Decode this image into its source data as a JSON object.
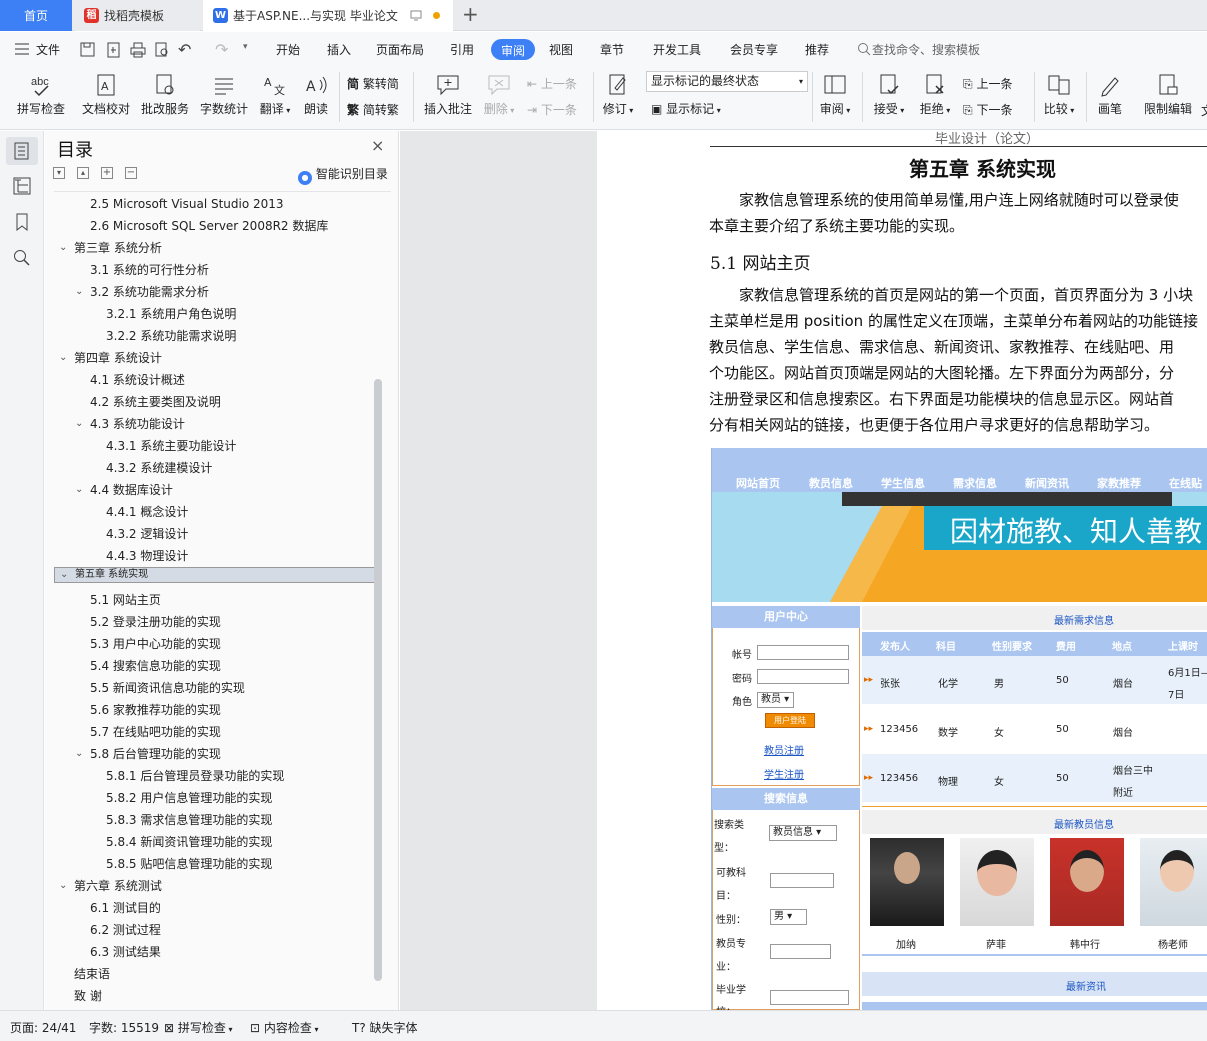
{
  "tabs": {
    "home": "首页",
    "templates": "找稻壳模板",
    "document": "基于ASP.NE...与实现 毕业论文"
  },
  "menu": {
    "file": "文件",
    "items": [
      "开始",
      "插入",
      "页面布局",
      "引用",
      "审阅",
      "视图",
      "章节",
      "开发工具",
      "会员专享",
      "推荐"
    ],
    "active": "审阅",
    "search_placeholder": "查找命令、搜索模板"
  },
  "ribbon": {
    "spell_check": "拼写检查",
    "doc_proofread": "文档校对",
    "review_service": "批改服务",
    "word_count": "字数统计",
    "translate": "翻译",
    "read_aloud": "朗读",
    "trad_to_simp": "繁转简",
    "simp_to_trad": "简转繁",
    "insert_comment": "插入批注",
    "delete": "删除",
    "prev": "上一条",
    "next": "下一条",
    "track_changes": "修订",
    "markup_state": "显示标记的最终状态",
    "show_markup": "显示标记",
    "review": "审阅",
    "accept": "接受",
    "reject": "拒绝",
    "prev2": "上一条",
    "next2": "下一条",
    "compare": "比较",
    "ink": "画笔",
    "restrict_edit": "限制编辑"
  },
  "toc": {
    "title": "目录",
    "smart_toc": "智能识别目录",
    "items": [
      {
        "text": "2.5 Microsoft Visual Studio 2013",
        "level": 2,
        "caret": ""
      },
      {
        "text": "2.6 Microsoft SQL Server 2008R2 数据库",
        "level": 2,
        "caret": ""
      },
      {
        "text": "第三章  系统分析",
        "level": 1,
        "caret": "down"
      },
      {
        "text": "3.1 系统的可行性分析",
        "level": 2,
        "caret": ""
      },
      {
        "text": "3.2 系统功能需求分析",
        "level": 2,
        "caret": "down"
      },
      {
        "text": "3.2.1 系统用户角色说明",
        "level": 3,
        "caret": ""
      },
      {
        "text": "3.2.2 系统功能需求说明",
        "level": 3,
        "caret": ""
      },
      {
        "text": "第四章  系统设计",
        "level": 1,
        "caret": "down"
      },
      {
        "text": "4.1 系统设计概述",
        "level": 2,
        "caret": ""
      },
      {
        "text": "4.2  系统主要类图及说明",
        "level": 2,
        "caret": ""
      },
      {
        "text": "4.3 系统功能设计",
        "level": 2,
        "caret": "down"
      },
      {
        "text": "4.3.1 系统主要功能设计",
        "level": 3,
        "caret": ""
      },
      {
        "text": "4.3.2 系统建模设计",
        "level": 3,
        "caret": ""
      },
      {
        "text": "4.4 数据库设计",
        "level": 2,
        "caret": "down"
      },
      {
        "text": "4.4.1  概念设计",
        "level": 3,
        "caret": ""
      },
      {
        "text": "4.3.2  逻辑设计",
        "level": 3,
        "caret": ""
      },
      {
        "text": "4.4.3  物理设计",
        "level": 3,
        "caret": ""
      },
      {
        "text": "第五章  系统实现",
        "level": 1,
        "caret": "down",
        "selected": true
      },
      {
        "text": "5.1 网站主页",
        "level": 2,
        "caret": ""
      },
      {
        "text": "5.2  登录注册功能的实现",
        "level": 2,
        "caret": ""
      },
      {
        "text": "5.3 用户中心功能的实现",
        "level": 2,
        "caret": ""
      },
      {
        "text": "5.4 搜索信息功能的实现",
        "level": 2,
        "caret": ""
      },
      {
        "text": "5.5 新闻资讯信息功能的实现",
        "level": 2,
        "caret": ""
      },
      {
        "text": "5.6 家教推荐功能的实现",
        "level": 2,
        "caret": ""
      },
      {
        "text": "5.7 在线贴吧功能的实现",
        "level": 2,
        "caret": ""
      },
      {
        "text": "5.8 后台管理功能的实现",
        "level": 2,
        "caret": "down"
      },
      {
        "text": "5.8.1  后台管理员登录功能的实现",
        "level": 3,
        "caret": ""
      },
      {
        "text": "5.8.2  用户信息管理功能的实现",
        "level": 3,
        "caret": ""
      },
      {
        "text": "5.8.3  需求信息管理功能的实现",
        "level": 3,
        "caret": ""
      },
      {
        "text": "5.8.4  新闻资讯管理功能的实现",
        "level": 3,
        "caret": ""
      },
      {
        "text": "5.8.5  贴吧信息管理功能的实现",
        "level": 3,
        "caret": ""
      },
      {
        "text": "第六章  系统测试",
        "level": 1,
        "caret": "down"
      },
      {
        "text": "6.1  测试目的",
        "level": 2,
        "caret": ""
      },
      {
        "text": "6.2  测试过程",
        "level": 2,
        "caret": ""
      },
      {
        "text": "6.3  测试结果",
        "level": 2,
        "caret": ""
      },
      {
        "text": "结束语",
        "level": 1,
        "caret": ""
      },
      {
        "text": "致    谢",
        "level": 1,
        "caret": ""
      }
    ]
  },
  "document": {
    "header": "毕业设计（论文）",
    "chapter_title": "第五章  系统实现",
    "para1": [
      "家教信息管理系统的使用简单易懂,用户连上网络就随时可以登录使",
      "本章主要介绍了系统主要功能的实现。"
    ],
    "section_title": "5.1 网站主页",
    "para2": [
      "家教信息管理系统的首页是网站的第一个页面，首页界面分为 3 小块",
      "主菜单栏是用 position 的属性定义在顶端，主菜单分布着网站的功能链接",
      "教员信息、学生信息、需求信息、新闻资讯、家教推荐、在线贴吧、用",
      "个功能区。网站首页顶端是网站的大图轮播。左下界面分为两部分，分",
      "注册登录区和信息搜索区。右下界面是功能模块的信息显示区。网站首",
      "分有相关网站的链接，也更便于各位用户寻求更好的信息帮助学习。"
    ]
  },
  "screenshot": {
    "nav": [
      "网站首页",
      "教员信息",
      "学生信息",
      "需求信息",
      "新闻资讯",
      "家教推荐",
      "在线贴"
    ],
    "banner_text": "因材施教、知人善教！",
    "user_center": "用户中心",
    "account_label": "帐号",
    "password_label": "密码",
    "role_label": "角色",
    "role_value": "教员",
    "login_button": "用户登陆",
    "teacher_register": "教员注册",
    "student_register": "学生注册",
    "search_info": "搜索信息",
    "search_type_label": [
      "搜索类",
      "型："
    ],
    "search_type_value": "教员信息",
    "subject_label": [
      "可教科",
      "目："
    ],
    "gender_label": "性别：",
    "gender_value": "男",
    "major_label": [
      "教员专",
      "业："
    ],
    "school_label": [
      "毕业学",
      "校："
    ],
    "latest_demand": "最新需求信息",
    "demand_headers": [
      "发布人",
      "科目",
      "性别要求",
      "费用",
      "地点",
      "上课时"
    ],
    "demand_rows": [
      {
        "publisher": "张张",
        "subject": "化学",
        "gender": "男",
        "fee": "50",
        "place": "烟台",
        "time": [
          "6月1日—",
          "7日"
        ]
      },
      {
        "publisher": "123456",
        "subject": "数学",
        "gender": "女",
        "fee": "50",
        "place": "烟台",
        "time": [
          "",
          ""
        ]
      },
      {
        "publisher": "123456",
        "subject": "物理",
        "gender": "女",
        "fee": "50",
        "place": [
          "烟台三中",
          "附近"
        ],
        "time": [
          "",
          ""
        ]
      }
    ],
    "latest_teachers": "最新教员信息",
    "teachers": [
      "加纳",
      "萨菲",
      "韩中行",
      "杨老师"
    ],
    "latest_news": "最新资讯"
  },
  "status": {
    "page": "页面: 24/41",
    "words": "字数: 15519",
    "spell": "拼写检查",
    "content_check": "内容检查",
    "missing_font": "缺失字体"
  }
}
